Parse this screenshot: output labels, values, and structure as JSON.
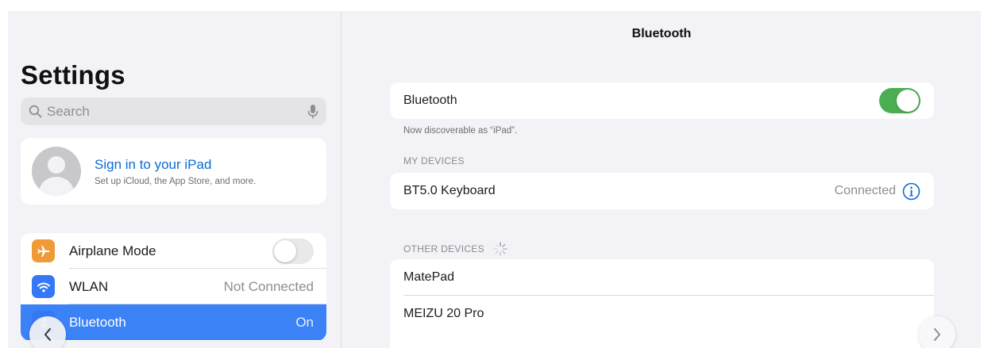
{
  "sidebar": {
    "title": "Settings",
    "search": {
      "placeholder": "Search",
      "icon": "magnifier-icon",
      "mic_icon": "microphone-icon"
    },
    "profile": {
      "title": "Sign in to your iPad",
      "subtitle": "Set up iCloud, the App Store, and more."
    },
    "items": [
      {
        "label": "Airplane Mode",
        "icon": "airplane-icon",
        "icon_color": "#f09a37",
        "control": "toggle",
        "on": false
      },
      {
        "label": "WLAN",
        "icon": "wifi-icon",
        "icon_color": "#3478f6",
        "value": "Not Connected"
      },
      {
        "label": "Bluetooth",
        "icon": "bluetooth-icon",
        "icon_color": "#3478f6",
        "value": "On",
        "selected": true
      }
    ]
  },
  "detail": {
    "nav_title": "Bluetooth",
    "bluetooth_toggle": {
      "label": "Bluetooth",
      "on": true
    },
    "discoverable_note": "Now discoverable as “iPad”.",
    "my_devices": {
      "header": "MY DEVICES",
      "devices": [
        {
          "name": "BT5.0 Keyboard",
          "status": "Connected"
        }
      ]
    },
    "other_devices": {
      "header": "OTHER DEVICES",
      "devices": [
        {
          "name": "MatePad"
        },
        {
          "name": "MEIZU 20 Pro"
        }
      ]
    }
  },
  "colors": {
    "accent": "#0a6cd6",
    "toggle_on": "#4cae52",
    "selection": "#3b82f6"
  }
}
